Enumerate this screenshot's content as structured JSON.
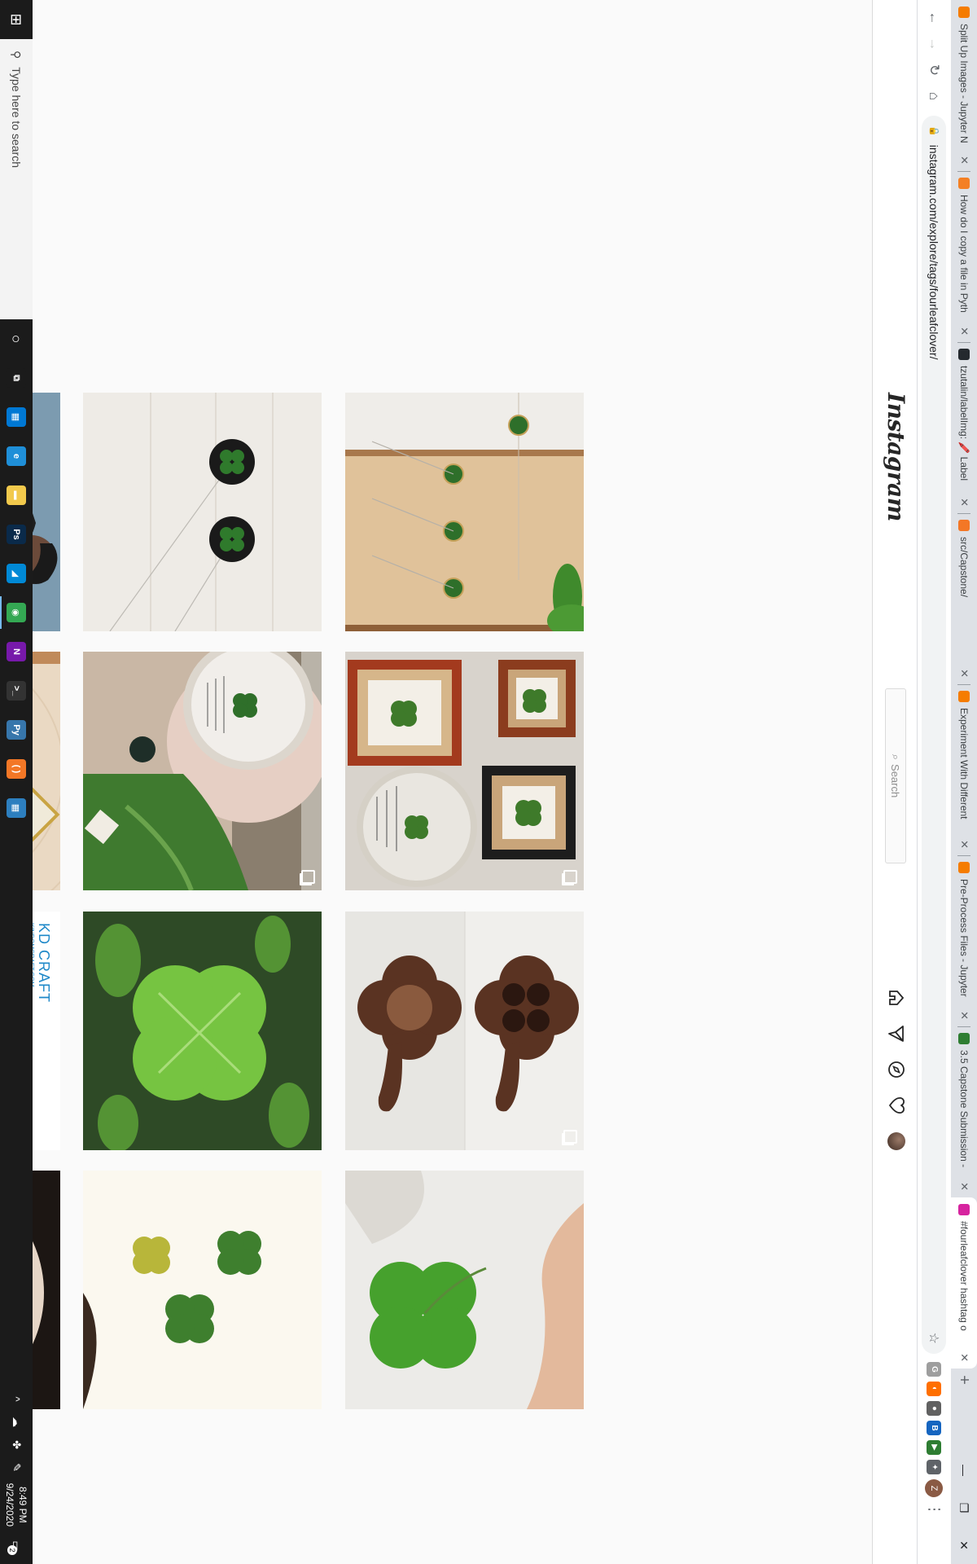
{
  "browser": {
    "tabs": [
      {
        "title": "Split Up Images - Jupyter N",
        "color": "#f57c00",
        "active": false
      },
      {
        "title": "How do I copy a file in Pyth",
        "color": "#f48024",
        "active": false
      },
      {
        "title": "tzutalin/labelImg: 🖍️ Label",
        "color": "#24292e",
        "active": false
      },
      {
        "title": "src/Capstone/",
        "color": "#f37726",
        "active": false
      },
      {
        "title": "Experiment With Different",
        "color": "#f57c00",
        "active": false
      },
      {
        "title": "Pre-Process Files - Jupyter",
        "color": "#f57c00",
        "active": false
      },
      {
        "title": "3.5 Capstone Submission -",
        "color": "#2e7d32",
        "active": false
      },
      {
        "title": "#fourleafclover hashtag o",
        "color": "#d6249f",
        "active": true
      }
    ],
    "new_tab_label": "+",
    "window_controls": {
      "minimize": "—",
      "restore": "❐",
      "close": "✕"
    },
    "nav": {
      "back": "←",
      "forward": "→",
      "reload": "↻",
      "home": "⌂"
    },
    "url": "instagram.com/explore/tags/fourleafclover/",
    "extensions": [
      {
        "label": "G",
        "color": "#9e9e9e"
      },
      {
        "label": "◐",
        "color": "#ff6f00"
      },
      {
        "label": "●",
        "color": "#616161"
      },
      {
        "label": "B",
        "color": "#1565c0"
      },
      {
        "label": "▶",
        "color": "#2e7d32"
      },
      {
        "label": "✦",
        "color": "#5f6368"
      }
    ],
    "profile_initial": "Z",
    "menu_glyph": "⋮"
  },
  "instagram": {
    "logo": "Instagram",
    "search_placeholder": "Search",
    "nav_icons": [
      "home-icon",
      "direct-icon",
      "explore-icon",
      "activity-icon",
      "profile-avatar"
    ]
  },
  "grid": {
    "tiles": [
      {
        "desc": "necklaces-on-wood",
        "row": 0,
        "col": 0,
        "multi": false
      },
      {
        "desc": "framed-clovers",
        "row": 0,
        "col": 1,
        "multi": true
      },
      {
        "desc": "wooden-clover-carving",
        "row": 0,
        "col": 2,
        "multi": true
      },
      {
        "desc": "hand-holding-clover",
        "row": 0,
        "col": 3,
        "multi": false
      },
      {
        "desc": "black-pendants",
        "row": 1,
        "col": 0,
        "multi": false
      },
      {
        "desc": "round-frame-and-plant",
        "row": 1,
        "col": 1,
        "multi": true
      },
      {
        "desc": "real-clover-closeup",
        "row": 1,
        "col": 2,
        "multi": false
      },
      {
        "desc": "clover-greeting-card",
        "row": 1,
        "col": 3,
        "multi": false
      },
      {
        "desc": "man-in-black-shirt",
        "row": 2,
        "col": 0,
        "multi": false
      },
      {
        "desc": "square-clover-pendants",
        "row": 2,
        "col": 1,
        "multi": false
      },
      {
        "desc": "kd-craft-ladybug-pin",
        "row": 2,
        "col": 2,
        "multi": false
      },
      {
        "desc": "cream-dish",
        "row": 2,
        "col": 3,
        "multi": false
      }
    ],
    "kd_craft": {
      "brand": "KD CRAFT",
      "site": "KINDOMCRAFT.COM",
      "prefix": "CRAFT"
    }
  },
  "taskbar": {
    "search_placeholder": "Type here to search",
    "apps": [
      {
        "name": "task-view",
        "glyph": "⧉",
        "color": "#1b1b1b"
      },
      {
        "name": "store",
        "glyph": "▦",
        "color": "#0078d4"
      },
      {
        "name": "edge",
        "glyph": "e",
        "color": "#1f8fd8"
      },
      {
        "name": "file-explorer",
        "glyph": "▬",
        "color": "#f2c94c"
      },
      {
        "name": "photoshop",
        "glyph": "Ps",
        "color": "#0a2a4a"
      },
      {
        "name": "azure",
        "glyph": "◢",
        "color": "#0089d6"
      },
      {
        "name": "chrome",
        "glyph": "◉",
        "color": "#34a853"
      },
      {
        "name": "onenote",
        "glyph": "N",
        "color": "#7719aa"
      },
      {
        "name": "terminal",
        "glyph": ">_",
        "color": "#333333"
      },
      {
        "name": "python",
        "glyph": "Py",
        "color": "#3776ab"
      },
      {
        "name": "jupyter",
        "glyph": "( )",
        "color": "#f37726"
      },
      {
        "name": "calculator",
        "glyph": "▦",
        "color": "#2d7fbf"
      }
    ],
    "tray_glyphs": [
      "^",
      "☁",
      "✤",
      "✎"
    ],
    "time": "8:49 PM",
    "date": "9/24/2020",
    "notification_count": "2"
  }
}
